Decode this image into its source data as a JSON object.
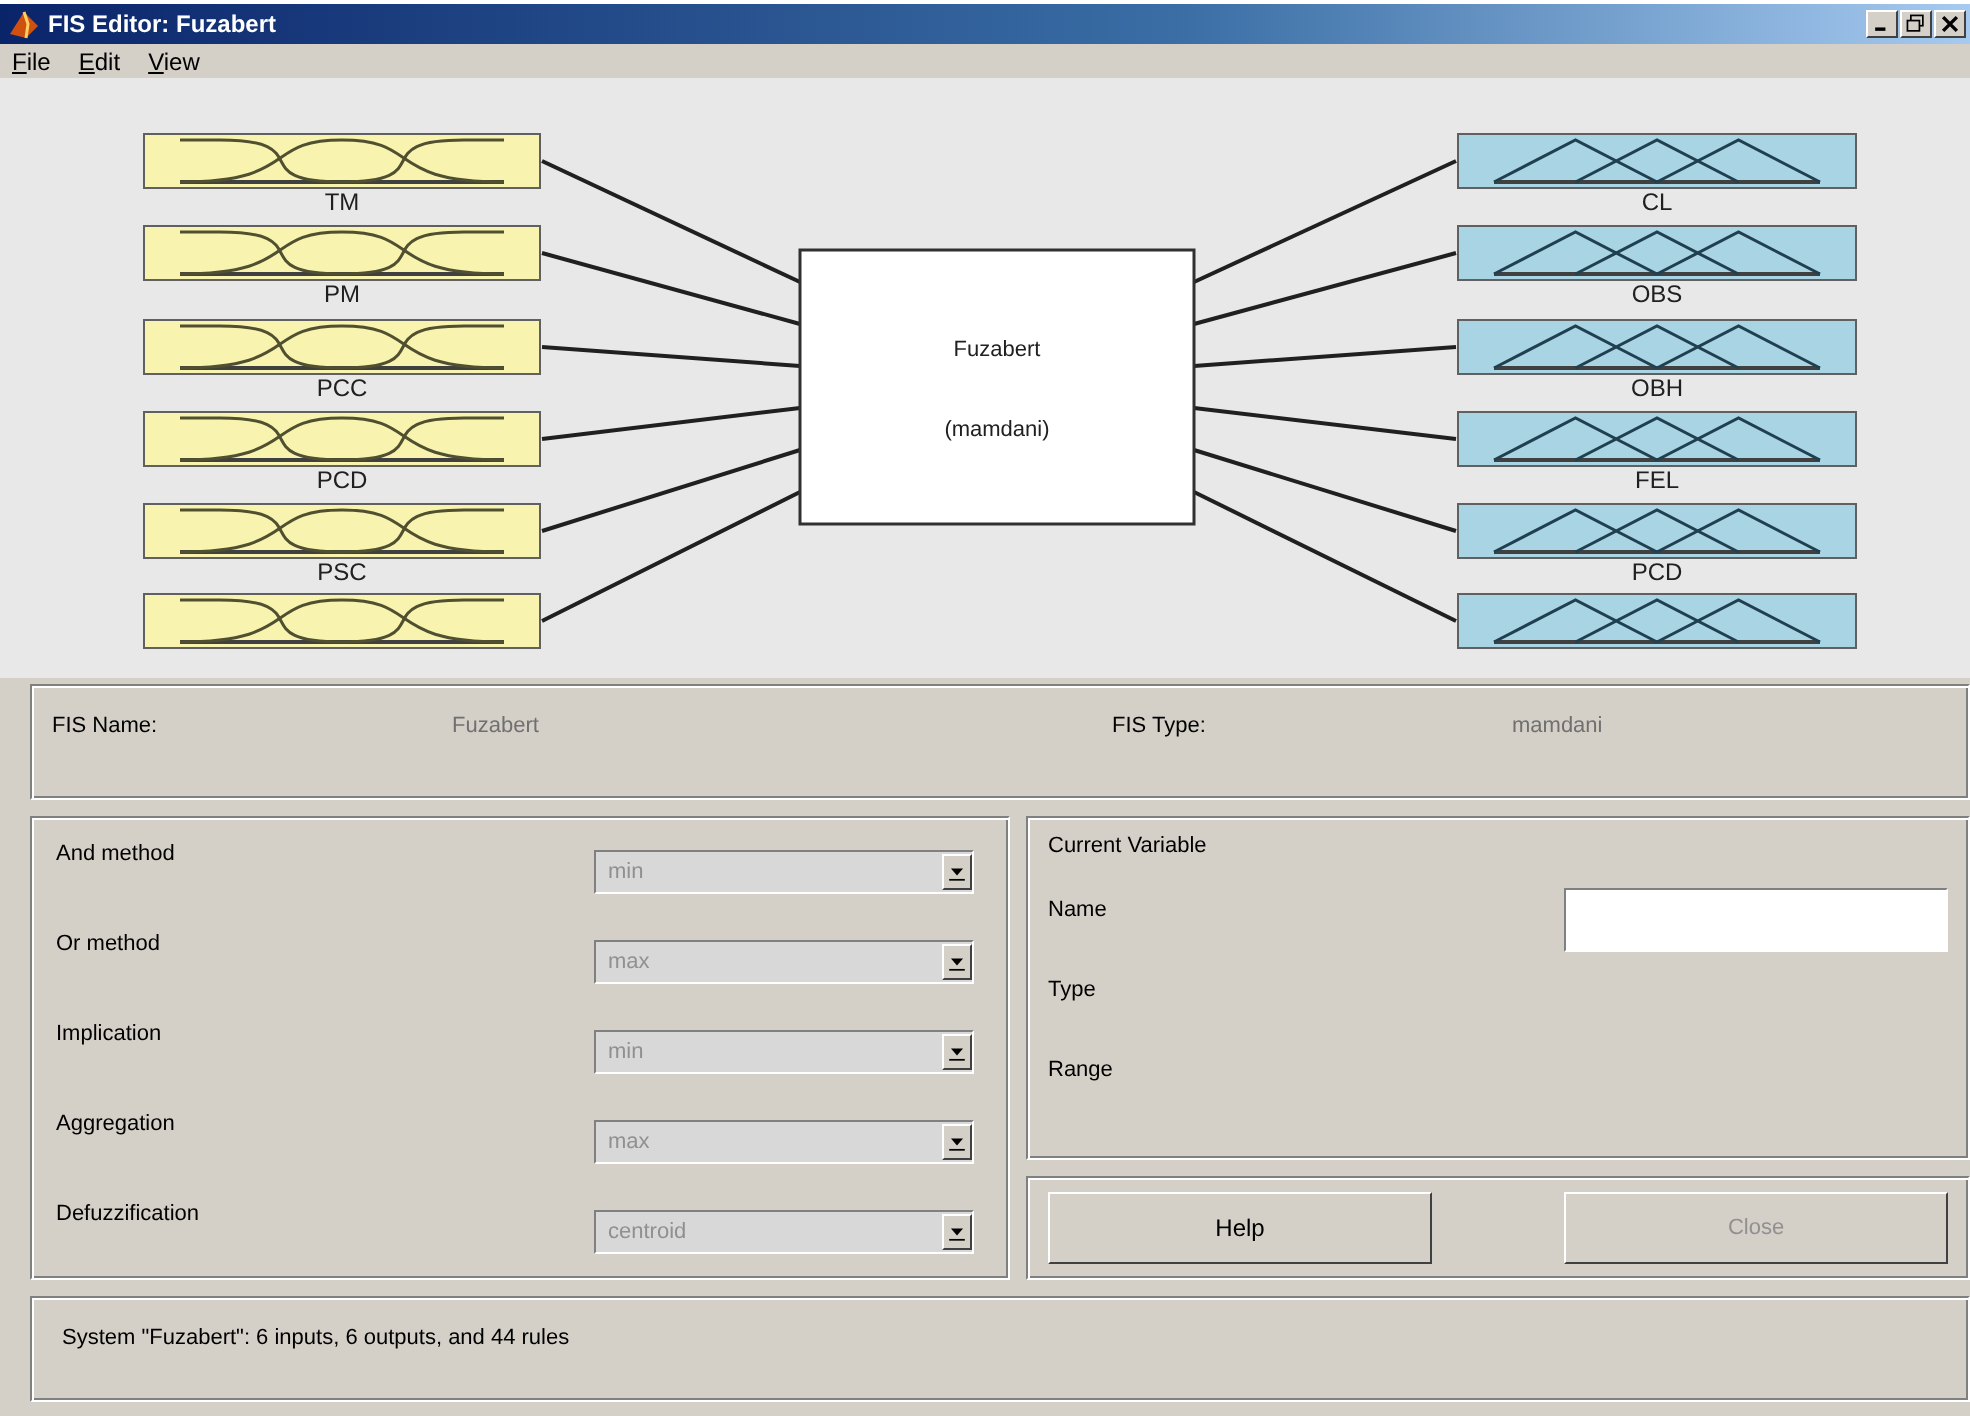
{
  "window": {
    "title": "FIS Editor: Fuzabert"
  },
  "menu": [
    {
      "label": "File"
    },
    {
      "label": "Edit"
    },
    {
      "label": "View"
    }
  ],
  "inputs": [
    {
      "kind": "input",
      "label": "TM"
    },
    {
      "kind": "input",
      "label": "PM"
    },
    {
      "kind": "input",
      "label": "PCC"
    },
    {
      "kind": "input",
      "label": "PCD"
    },
    {
      "kind": "input",
      "label": "PSC"
    },
    {
      "kind": "input"
    }
  ],
  "outputs": [
    {
      "kind": "output",
      "label": "CL"
    },
    {
      "kind": "output",
      "label": "OBS"
    },
    {
      "kind": "output",
      "label": "OBH"
    },
    {
      "kind": "output",
      "label": "FEL"
    },
    {
      "kind": "output",
      "label": "PCD"
    },
    {
      "kind": "output"
    }
  ],
  "center_box": {
    "name": "Fuzabert",
    "type": "(mamdani)"
  },
  "fis_info": [
    {
      "label": "FIS Name:",
      "value": "Fuzabert"
    },
    {
      "label": "FIS Type:",
      "value": "mamdani"
    }
  ],
  "methods": [
    {
      "label": "And method",
      "value": "min",
      "disabled": true
    },
    {
      "label": "Or method",
      "value": "max",
      "disabled": true
    },
    {
      "label": "Implication",
      "value": "min",
      "disabled": true
    },
    {
      "label": "Aggregation",
      "value": "max",
      "disabled": true
    },
    {
      "label": "Defuzzification",
      "value": "centroid",
      "disabled": true
    }
  ],
  "current_variable": {
    "title": "Current Variable",
    "fields": [
      {
        "label": "Name",
        "kind": "input"
      },
      {
        "label": "Type",
        "kind": "text"
      },
      {
        "label": "Range",
        "kind": "text"
      }
    ]
  },
  "buttons": [
    {
      "label": "Help",
      "disabled": false
    },
    {
      "label": "Close",
      "disabled": true
    }
  ],
  "status": "System \"Fuzabert\": 6 inputs, 6 outputs, and 44 rules"
}
